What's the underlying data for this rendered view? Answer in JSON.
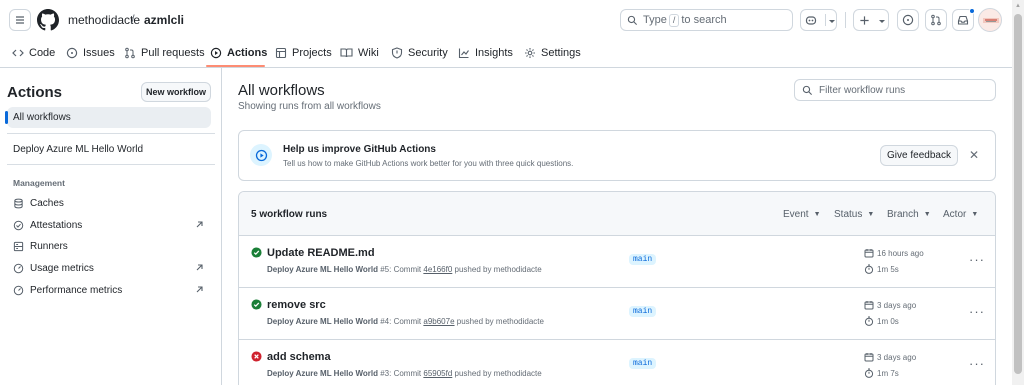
{
  "header": {
    "owner": "methodidacte",
    "separator": "/",
    "repo": "azmlcli",
    "search": {
      "type_label": "Type",
      "slash_key": "/",
      "search_label": "to search"
    }
  },
  "tabs": [
    {
      "label": "Code"
    },
    {
      "label": "Issues"
    },
    {
      "label": "Pull requests"
    },
    {
      "label": "Actions"
    },
    {
      "label": "Projects"
    },
    {
      "label": "Wiki"
    },
    {
      "label": "Security"
    },
    {
      "label": "Insights"
    },
    {
      "label": "Settings"
    }
  ],
  "sidebar": {
    "title": "Actions",
    "new_workflow": "New workflow",
    "all_workflows": "All workflows",
    "workflow": "Deploy Azure ML Hello World",
    "section": "Management",
    "items": [
      {
        "label": "Caches"
      },
      {
        "label": "Attestations"
      },
      {
        "label": "Runners"
      },
      {
        "label": "Usage metrics"
      },
      {
        "label": "Performance metrics"
      }
    ]
  },
  "main": {
    "title": "All workflows",
    "subtitle": "Showing runs from all workflows",
    "filter_placeholder": "Filter workflow runs"
  },
  "banner": {
    "title": "Help us improve GitHub Actions",
    "text": "Tell us how to make GitHub Actions work better for you with three quick questions.",
    "button": "Give feedback",
    "close": "✕"
  },
  "runs": {
    "count": "5 workflow runs",
    "filters": [
      "Event",
      "Status",
      "Branch",
      "Actor"
    ],
    "items": [
      {
        "status": "success",
        "title": "Update README.md",
        "workflow": "Deploy Azure ML Hello World",
        "run_number": "#5",
        "commit_label": "Commit",
        "sha": "4e166f0",
        "pushed_by": "pushed by methodidacte",
        "branch": "main",
        "when": "16 hours ago",
        "duration": "1m 5s"
      },
      {
        "status": "success",
        "title": "remove src",
        "workflow": "Deploy Azure ML Hello World",
        "run_number": "#4",
        "commit_label": "Commit",
        "sha": "a9b607e",
        "pushed_by": "pushed by methodidacte",
        "branch": "main",
        "when": "3 days ago",
        "duration": "1m 0s"
      },
      {
        "status": "failure",
        "title": "add schema",
        "workflow": "Deploy Azure ML Hello World",
        "run_number": "#3",
        "commit_label": "Commit",
        "sha": "65905fd",
        "pushed_by": "pushed by methodidacte",
        "branch": "main",
        "when": "3 days ago",
        "duration": "1m 7s"
      }
    ]
  },
  "colors": {
    "accent": "#0969da",
    "success": "#1a7f37",
    "failure": "#cf222e",
    "tab_underline": "#fd8c73"
  }
}
